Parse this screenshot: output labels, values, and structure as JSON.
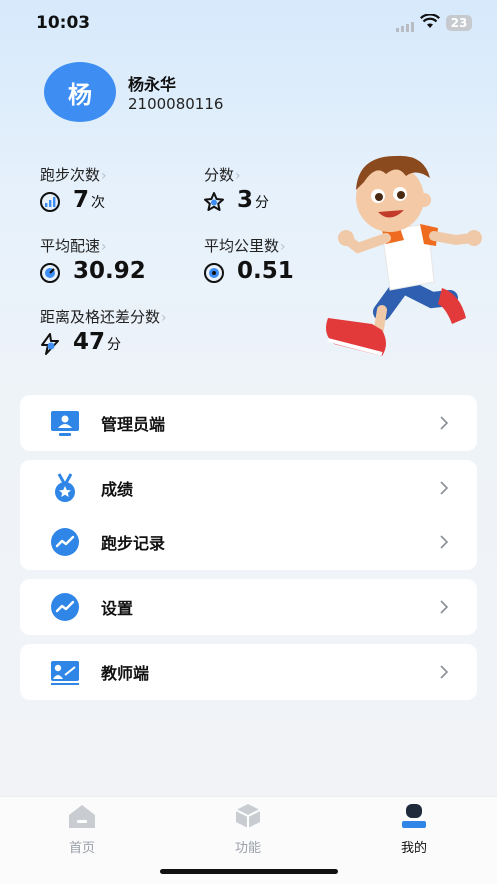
{
  "status": {
    "time": "10:03",
    "battery": "23"
  },
  "profile": {
    "avatar_char": "杨",
    "name": "杨永华",
    "id": "2100080116"
  },
  "stats": {
    "run_count": {
      "label": "跑步次数",
      "value": "7",
      "unit": "次"
    },
    "score": {
      "label": "分数",
      "value": "3",
      "unit": "分"
    },
    "avg_pace": {
      "label": "平均配速",
      "value": "30.92"
    },
    "avg_km": {
      "label": "平均公里数",
      "value": "0.51"
    },
    "gap_to_pass": {
      "label": "距离及格还差分数",
      "value": "47",
      "unit": "分"
    }
  },
  "menu": {
    "admin": "管理员端",
    "grades": "成绩",
    "run_records": "跑步记录",
    "settings": "设置",
    "teacher": "教师端"
  },
  "tabs": {
    "home": "首页",
    "functions": "功能",
    "mine": "我的"
  },
  "colors": {
    "accent": "#3d8df3",
    "active_tab": "#1f2a3a"
  }
}
